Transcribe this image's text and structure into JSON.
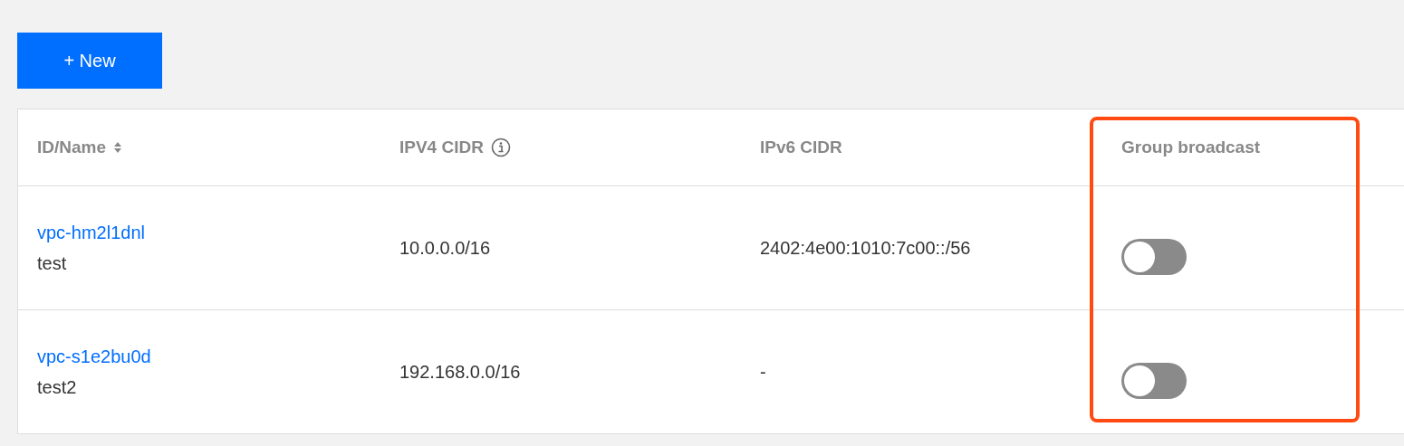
{
  "new_button": "+ New",
  "table": {
    "columns": [
      {
        "label": "ID/Name",
        "kind": "sortable",
        "highlighted": false
      },
      {
        "label": "IPV4 CIDR",
        "kind": "info",
        "highlighted": false
      },
      {
        "label": "IPv6 CIDR",
        "kind": "plain",
        "highlighted": false
      },
      {
        "label": "Group broadcast",
        "kind": "plain",
        "highlighted": true
      }
    ],
    "rows": [
      {
        "id": "vpc-hm2l1dnl",
        "name": "test",
        "ipv4": "10.0.0.0/16",
        "ipv6": "2402:4e00:1010:7c00::/56",
        "broadcast_on": false
      },
      {
        "id": "vpc-s1e2bu0d",
        "name": "test2",
        "ipv4": "192.168.0.0/16",
        "ipv6": "-",
        "broadcast_on": false
      }
    ]
  }
}
